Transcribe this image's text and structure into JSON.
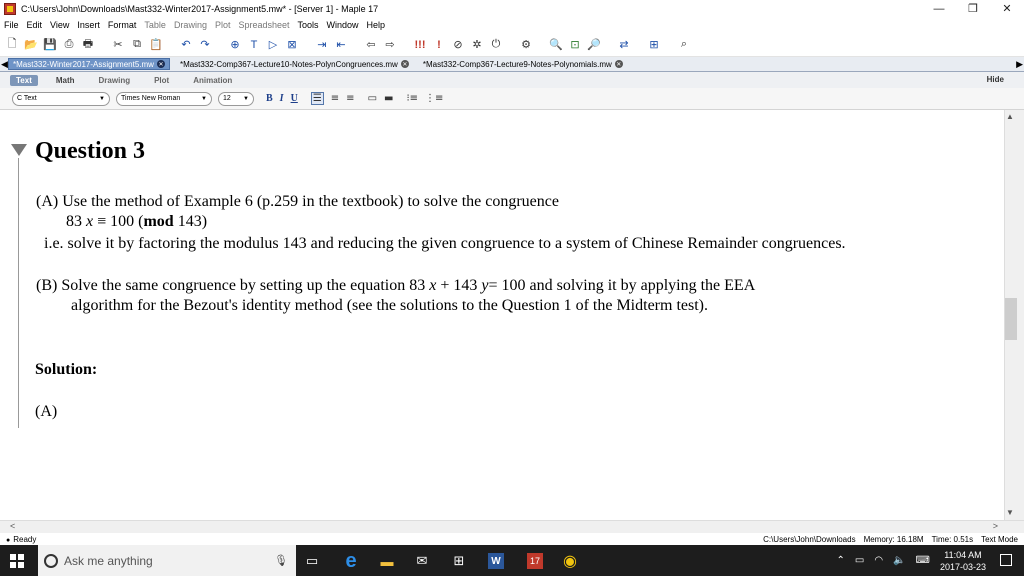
{
  "window": {
    "title": "C:\\Users\\John\\Downloads\\Mast332-Winter2017-Assignment5.mw* - [Server 1] - Maple 17",
    "minimize": "—",
    "restore": "❐",
    "close": "✕"
  },
  "menu": [
    "File",
    "Edit",
    "View",
    "Insert",
    "Format",
    "Table",
    "Drawing",
    "Plot",
    "Spreadsheet",
    "Tools",
    "Window",
    "Help"
  ],
  "menu_dim": [
    "Table",
    "Drawing",
    "Plot",
    "Spreadsheet"
  ],
  "doc_tabs": [
    {
      "label": "*Mast332-Winter2017-Assignment5.mw",
      "active": true
    },
    {
      "label": "*Mast332-Comp367-Lecture10-Notes-PolynCongruences.mw",
      "active": false
    },
    {
      "label": "*Mast332-Comp367-Lecture9-Notes-Polynomials.mw",
      "active": false
    }
  ],
  "mode_tabs": [
    "Text",
    "Math",
    "Drawing",
    "Plot",
    "Animation"
  ],
  "hide_label": "Hide",
  "format": {
    "style": "C  Text",
    "font": "Times New Roman",
    "size": "12",
    "bold": "B",
    "italic": "I",
    "underline": "U"
  },
  "document": {
    "heading": "Question 3",
    "partA_line1": "(A) Use the method of Example 6 (p.259 in the textbook) to solve the congruence",
    "math_a": "83",
    "math_x": "x",
    "math_equiv": "≡ 100",
    "math_mod": "mod",
    "math_143": "143",
    "partA_line3": "i.e. solve it by factoring the modulus 143 and reducing the given congruence to a system of Chinese Remainder congruences.",
    "partB_start": "(B)  Solve the same congruence by setting up the equation 83",
    "partB_x": "x",
    "partB_mid": "+ 143",
    "partB_y": "y",
    "partB_end": "= 100 and solving it by applying the EEA",
    "partB_line2": "algorithm for the Bezout's identity method (see the solutions to the Question 1 of the Midterm test).",
    "solution_label": "Solution:",
    "sol_a": "(A)"
  },
  "status": {
    "ready": "Ready",
    "path": "C:\\Users\\John\\Downloads",
    "memory": "Memory: 16.18M",
    "time": "Time: 0.51s",
    "mode": "Text Mode"
  },
  "taskbar": {
    "search_placeholder": "Ask me anything",
    "clock_time": "11:04 AM",
    "clock_date": "2017-03-23"
  }
}
